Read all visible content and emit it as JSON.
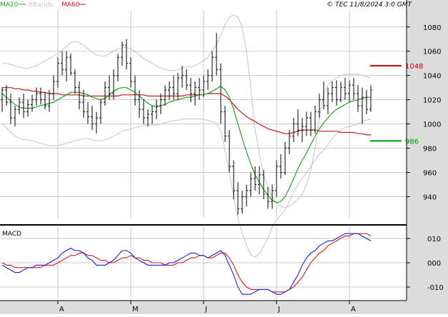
{
  "header": {
    "legend": [
      {
        "label": "MA20",
        "color": "#21a121"
      },
      {
        "label": "BBands",
        "color": "#c4c4c4"
      },
      {
        "label": "MA60",
        "color": "#c01818"
      }
    ],
    "copyright": "© TEC 11/8/2024 3:0 GMT"
  },
  "colors": {
    "candles": "#000000",
    "ma20": "#21a121",
    "ma60": "#c01818",
    "bbands": "#c4c4c4",
    "macd_line": "#1c1ccc",
    "signal_line": "#cc1c1c",
    "grid": "#c8c8c8",
    "axis_band": "#dcdcdc",
    "panel_bg": "#ffffff"
  },
  "chart_data": [
    {
      "type": "line",
      "title": "",
      "x": [
        "A",
        "M",
        "J",
        "J",
        "A"
      ],
      "price": {
        "ylim": [
          922,
          1094
        ],
        "ticks": [
          940,
          960,
          980,
          1000,
          1020,
          1040,
          1060,
          1080
        ],
        "levels": [
          {
            "label": "1048",
            "value": 1048,
            "color": "#cc0000"
          },
          {
            "label": "986",
            "value": 986,
            "color": "#009900"
          }
        ],
        "bars": [
          [
            1020,
            1030,
            1010,
            1028
          ],
          [
            1028,
            1032,
            1015,
            1018
          ],
          [
            1018,
            1025,
            1000,
            1005
          ],
          [
            1005,
            1015,
            998,
            1012
          ],
          [
            1012,
            1022,
            1008,
            1018
          ],
          [
            1018,
            1025,
            1005,
            1010
          ],
          [
            1010,
            1020,
            1006,
            1016
          ],
          [
            1016,
            1024,
            1010,
            1020
          ],
          [
            1020,
            1030,
            1015,
            1025
          ],
          [
            1025,
            1030,
            1016,
            1020
          ],
          [
            1020,
            1026,
            1012,
            1015
          ],
          [
            1015,
            1028,
            1010,
            1025
          ],
          [
            1025,
            1040,
            1020,
            1035
          ],
          [
            1035,
            1055,
            1030,
            1050
          ],
          [
            1050,
            1060,
            1040,
            1045
          ],
          [
            1045,
            1060,
            1035,
            1055
          ],
          [
            1055,
            1058,
            1040,
            1042
          ],
          [
            1042,
            1045,
            1025,
            1030
          ],
          [
            1030,
            1035,
            1012,
            1018
          ],
          [
            1018,
            1028,
            1005,
            1010
          ],
          [
            1010,
            1018,
            1000,
            1006
          ],
          [
            1006,
            1015,
            995,
            1000
          ],
          [
            1000,
            1010,
            992,
            1005
          ],
          [
            1005,
            1020,
            1000,
            1018
          ],
          [
            1018,
            1035,
            1015,
            1030
          ],
          [
            1030,
            1040,
            1020,
            1025
          ],
          [
            1025,
            1045,
            1020,
            1040
          ],
          [
            1040,
            1058,
            1035,
            1055
          ],
          [
            1055,
            1068,
            1048,
            1065
          ],
          [
            1065,
            1070,
            1045,
            1050
          ],
          [
            1050,
            1055,
            1030,
            1035
          ],
          [
            1035,
            1040,
            1015,
            1020
          ],
          [
            1020,
            1028,
            1005,
            1012
          ],
          [
            1012,
            1020,
            1000,
            1005
          ],
          [
            1005,
            1012,
            998,
            1008
          ],
          [
            1008,
            1015,
            1000,
            1010
          ],
          [
            1010,
            1020,
            1004,
            1015
          ],
          [
            1015,
            1025,
            1008,
            1020
          ],
          [
            1020,
            1032,
            1015,
            1028
          ],
          [
            1028,
            1035,
            1020,
            1030
          ],
          [
            1030,
            1040,
            1020,
            1025
          ],
          [
            1025,
            1042,
            1020,
            1038
          ],
          [
            1038,
            1048,
            1030,
            1040
          ],
          [
            1040,
            1045,
            1028,
            1032
          ],
          [
            1032,
            1038,
            1018,
            1025
          ],
          [
            1025,
            1035,
            1015,
            1030
          ],
          [
            1030,
            1038,
            1020,
            1028
          ],
          [
            1028,
            1040,
            1022,
            1035
          ],
          [
            1035,
            1045,
            1028,
            1040
          ],
          [
            1040,
            1060,
            1035,
            1055
          ],
          [
            1055,
            1075,
            1040,
            1045
          ],
          [
            1045,
            1050,
            1000,
            1010
          ],
          [
            1010,
            1015,
            985,
            990
          ],
          [
            990,
            995,
            960,
            965
          ],
          [
            965,
            970,
            938,
            945
          ],
          [
            945,
            952,
            925,
            930
          ],
          [
            930,
            945,
            926,
            940
          ],
          [
            940,
            950,
            932,
            945
          ],
          [
            945,
            960,
            940,
            955
          ],
          [
            955,
            965,
            945,
            950
          ],
          [
            950,
            965,
            942,
            958
          ],
          [
            958,
            962,
            938,
            942
          ],
          [
            942,
            948,
            930,
            936
          ],
          [
            936,
            950,
            930,
            945
          ],
          [
            945,
            970,
            940,
            965
          ],
          [
            965,
            975,
            955,
            960
          ],
          [
            960,
            985,
            958,
            980
          ],
          [
            980,
            995,
            975,
            990
          ],
          [
            990,
            1005,
            985,
            1000
          ],
          [
            1000,
            1012,
            990,
            995
          ],
          [
            995,
            1005,
            985,
            998
          ],
          [
            998,
            1010,
            990,
            1005
          ],
          [
            1005,
            1010,
            990,
            995
          ],
          [
            995,
            1015,
            992,
            1010
          ],
          [
            1010,
            1025,
            1005,
            1020
          ],
          [
            1020,
            1035,
            1012,
            1015
          ],
          [
            1015,
            1030,
            1008,
            1025
          ],
          [
            1025,
            1035,
            1018,
            1030
          ],
          [
            1030,
            1036,
            1015,
            1020
          ],
          [
            1020,
            1035,
            1018,
            1030
          ],
          [
            1030,
            1038,
            1020,
            1025
          ],
          [
            1025,
            1036,
            1018,
            1032
          ],
          [
            1032,
            1038,
            1020,
            1025
          ],
          [
            1025,
            1032,
            1010,
            1015
          ],
          [
            1015,
            1030,
            1000,
            1022
          ],
          [
            1022,
            1028,
            1008,
            1012
          ],
          [
            1012,
            1032,
            1010,
            1028
          ]
        ],
        "ma20": [
          1025,
          1022,
          1019,
          1016,
          1014,
          1013,
          1013,
          1013,
          1014,
          1015,
          1016,
          1017,
          1018,
          1020,
          1022,
          1024,
          1026,
          1026,
          1026,
          1025,
          1024,
          1022,
          1021,
          1020,
          1021,
          1024,
          1027,
          1029,
          1030,
          1030,
          1028,
          1026,
          1023,
          1020,
          1017,
          1015,
          1014,
          1015,
          1016,
          1018,
          1019,
          1020,
          1021,
          1022,
          1022,
          1023,
          1024,
          1024,
          1025,
          1027,
          1029,
          1031,
          1028,
          1022,
          1012,
          1000,
          988,
          977,
          967,
          958,
          952,
          946,
          941,
          937,
          935,
          936,
          940,
          947,
          955,
          963,
          970,
          976,
          983,
          990,
          996,
          1001,
          1005,
          1009,
          1012,
          1014,
          1016,
          1018,
          1019,
          1020,
          1021,
          1022,
          1022
        ],
        "ma60": [
          1030,
          1030,
          1030,
          1029,
          1029,
          1028,
          1028,
          1027,
          1027,
          1026,
          1026,
          1025,
          1025,
          1025,
          1024,
          1024,
          1024,
          1024,
          1024,
          1023,
          1023,
          1023,
          1023,
          1023,
          1023,
          1023,
          1023,
          1023,
          1024,
          1024,
          1024,
          1024,
          1024,
          1024,
          1023,
          1023,
          1023,
          1023,
          1023,
          1023,
          1023,
          1023,
          1023,
          1024,
          1024,
          1024,
          1024,
          1024,
          1025,
          1025,
          1025,
          1025,
          1023,
          1020,
          1016,
          1012,
          1009,
          1006,
          1004,
          1002,
          1000,
          998,
          996,
          995,
          994,
          993,
          992,
          992,
          993,
          994,
          995,
          995,
          995,
          995,
          994,
          994,
          994,
          994,
          994,
          993,
          993,
          993,
          993,
          992,
          992,
          991,
          991
        ],
        "bb_upper": [
          1050,
          1050,
          1049,
          1048,
          1047,
          1046,
          1046,
          1047,
          1048,
          1050,
          1052,
          1054,
          1056,
          1058,
          1061,
          1064,
          1067,
          1068,
          1067,
          1065,
          1062,
          1059,
          1057,
          1056,
          1056,
          1058,
          1060,
          1062,
          1063,
          1063,
          1062,
          1060,
          1057,
          1054,
          1052,
          1050,
          1048,
          1046,
          1045,
          1044,
          1044,
          1045,
          1046,
          1047,
          1047,
          1048,
          1050,
          1052,
          1055,
          1060,
          1066,
          1073,
          1082,
          1088,
          1090,
          1088,
          1080,
          1060,
          1030,
          995,
          975,
          958,
          948,
          940,
          935,
          932,
          931,
          932,
          935,
          938,
          942,
          950,
          962,
          980,
          1005,
          1025,
          1032,
          1036,
          1038,
          1040,
          1041,
          1041,
          1041,
          1041,
          1040,
          1039,
          1038
        ],
        "bb_lower": [
          1000,
          997,
          993,
          990,
          988,
          987,
          987,
          986,
          985,
          984,
          983,
          982,
          982,
          982,
          983,
          984,
          985,
          986,
          987,
          988,
          988,
          987,
          986,
          986,
          987,
          988,
          990,
          992,
          994,
          995,
          996,
          997,
          998,
          999,
          999,
          999,
          999,
          1000,
          1001,
          1002,
          1003,
          1003,
          1004,
          1004,
          1004,
          1004,
          1004,
          1004,
          1003,
          1002,
          1000,
          995,
          978,
          960,
          940,
          922,
          910,
          900,
          892,
          890,
          893,
          899,
          906,
          915,
          921,
          925,
          929,
          936,
          944,
          950,
          955,
          960,
          965,
          970,
          975,
          978,
          983,
          988,
          992,
          995,
          997,
          998,
          999,
          1000,
          1002,
          1003,
          1004
        ]
      }
    },
    {
      "type": "line",
      "title": "MACD",
      "x": [
        "A",
        "M",
        "J",
        "J",
        "A"
      ],
      "ylim": [
        -15,
        15
      ],
      "ticks": [
        -10,
        0,
        10
      ],
      "tick_labels": [
        "-010",
        "000",
        "010"
      ],
      "series": [
        {
          "name": "",
          "values": [
            -1,
            -2,
            -3,
            -4,
            -4,
            -3,
            -2,
            -2,
            -1,
            -1,
            -1,
            0,
            1,
            2,
            4,
            5,
            6,
            5,
            5,
            4,
            2,
            1,
            -1,
            -1,
            -1,
            0,
            1,
            3,
            5,
            5,
            4,
            2,
            1,
            0,
            -1,
            -1,
            -1,
            -1,
            -1,
            0,
            0,
            1,
            2,
            3,
            4,
            4,
            3,
            3,
            2,
            3,
            4,
            5,
            3,
            -1,
            -5,
            -10,
            -13,
            -13,
            -13,
            -12,
            -11,
            -11,
            -11,
            -12,
            -13,
            -13,
            -12,
            -11,
            -8,
            -5,
            -1,
            2,
            4,
            5,
            7,
            8,
            9,
            9,
            10,
            11,
            12,
            12,
            12,
            12,
            11,
            10,
            9
          ]
        },
        {
          "name": "",
          "values": [
            0,
            -1,
            -1,
            -2,
            -2,
            -2,
            -2,
            -2,
            -2,
            -2,
            -1,
            -1,
            -1,
            0,
            1,
            2,
            3,
            3,
            4,
            4,
            3,
            3,
            2,
            1,
            1,
            0,
            0,
            1,
            2,
            2,
            3,
            2,
            2,
            1,
            1,
            0,
            0,
            0,
            -1,
            -1,
            -1,
            0,
            0,
            1,
            2,
            2,
            3,
            3,
            2,
            2,
            3,
            4,
            4,
            2,
            -1,
            -5,
            -8,
            -10,
            -11,
            -11,
            -11,
            -11,
            -11,
            -12,
            -12,
            -12,
            -12,
            -11,
            -10,
            -8,
            -6,
            -3,
            0,
            2,
            4,
            5,
            7,
            8,
            9,
            10,
            11,
            11,
            12,
            12,
            12,
            12,
            11
          ]
        }
      ]
    }
  ]
}
